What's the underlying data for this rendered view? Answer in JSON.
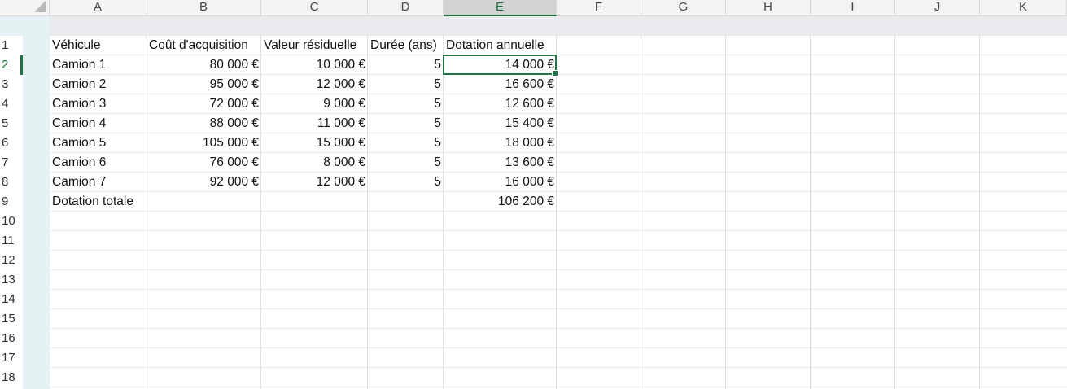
{
  "columns": [
    "A",
    "B",
    "C",
    "D",
    "E",
    "F",
    "G",
    "H",
    "I",
    "J",
    "K"
  ],
  "selected_column": "E",
  "rows": [
    "1",
    "2",
    "3",
    "4",
    "5",
    "6",
    "7",
    "8",
    "9",
    "10",
    "11",
    "12",
    "13",
    "14",
    "15",
    "16",
    "17",
    "18"
  ],
  "selected_row": "2",
  "table": {
    "headers": [
      "Véhicule",
      "Coût d'acquisition",
      "Valeur résiduelle",
      "Durée (ans)",
      "Dotation annuelle"
    ],
    "data": [
      [
        "Camion 1",
        "80 000 €",
        "10 000 €",
        "5",
        "14 000 €"
      ],
      [
        "Camion 2",
        "95 000 €",
        "12 000 €",
        "5",
        "16 600 €"
      ],
      [
        "Camion 3",
        "72 000 €",
        "9 000 €",
        "5",
        "12 600 €"
      ],
      [
        "Camion 4",
        "88 000 €",
        "11 000 €",
        "5",
        "15 400 €"
      ],
      [
        "Camion 5",
        "105 000 €",
        "15 000 €",
        "5",
        "18 000 €"
      ],
      [
        "Camion 6",
        "76 000 €",
        "8 000 €",
        "5",
        "13 600 €"
      ],
      [
        "Camion 7",
        "92 000 €",
        "12 000 €",
        "5",
        "16 000 €"
      ]
    ],
    "total_label": "Dotation totale",
    "total_value": "106 200 €"
  },
  "active_cell": "E2",
  "colors": {
    "accent": "#217346",
    "header_bg": "#f3f3f3",
    "gridline": "#e1e1e1"
  }
}
